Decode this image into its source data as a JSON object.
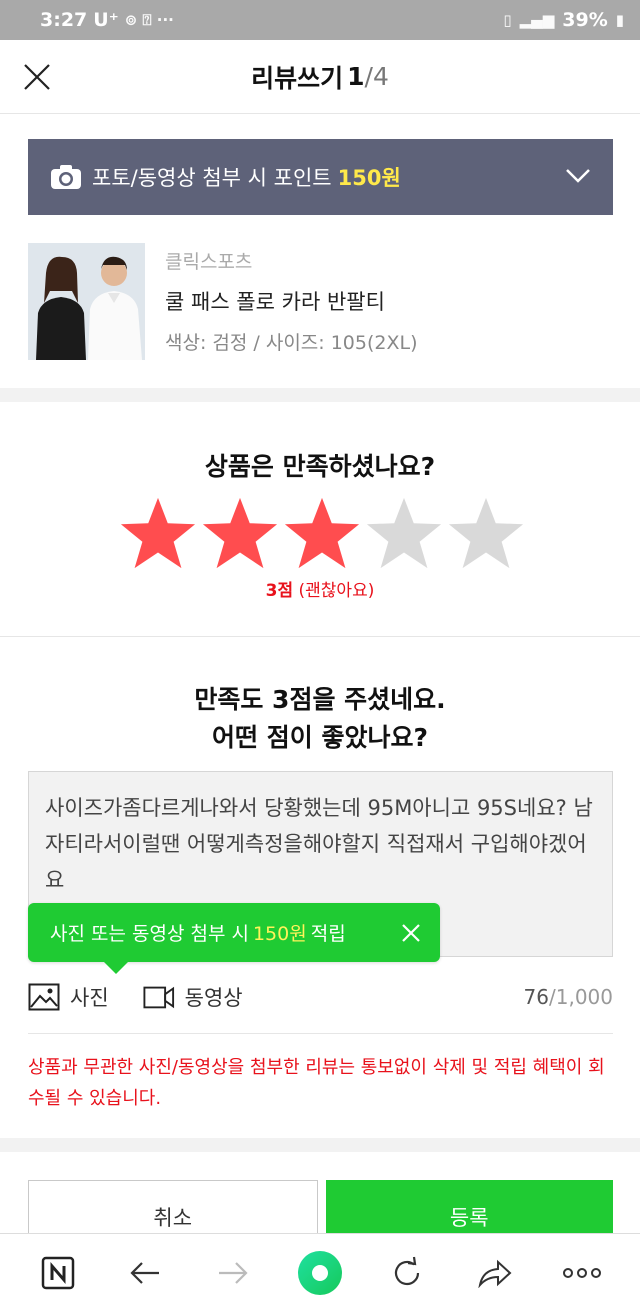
{
  "status_bar": {
    "time": "3:27",
    "carrier": "U⁺",
    "extra": "⊚ ⍰ ···",
    "signal": "📶",
    "battery": "39%"
  },
  "header": {
    "title": "리뷰쓰기",
    "page_current": "1",
    "page_total": "/4"
  },
  "banner": {
    "text": "포토/동영상 첨부 시 포인트",
    "points": "150원"
  },
  "product": {
    "brand": "클릭스포츠",
    "name": "쿨 패스 폴로 카라 반팔티",
    "option": "색상: 검정 / 사이즈: 105(2XL)"
  },
  "rating": {
    "question": "상품은 만족하셨나요?",
    "value": 3,
    "max": 5,
    "score_label": "3점",
    "score_desc": "(괜찮아요)",
    "colors": {
      "filled": "#ff4d4f",
      "empty": "#d9d9d9"
    }
  },
  "review": {
    "question_line1": "만족도 3점을 주셨네요.",
    "question_line2": "어떤 점이 좋았나요?",
    "text": "사이즈가좀다르게나와서 당황했는데 95M아니고 95S네요? 남자티라서이럴땐 어떻게측정을해야할지 직접재서 구입해야겠어요"
  },
  "tooltip": {
    "prefix": "사진 또는 동영상 첨부 시",
    "points": "150원",
    "suffix": "적립"
  },
  "attach": {
    "photo_label": "사진",
    "video_label": "동영상",
    "count": "76",
    "limit": "/1,000"
  },
  "warning": "상품과 무관한 사진/동영상을 첨부한 리뷰는 통보없이 삭제 및 적립 혜택이 회수될 수 있습니다.",
  "buttons": {
    "cancel": "취소",
    "submit": "등록"
  },
  "colors": {
    "brand_green": "#1fcb33",
    "banner_bg": "#5e6279",
    "highlight_yellow": "#ffe94a",
    "warning_red": "#e8121c"
  }
}
